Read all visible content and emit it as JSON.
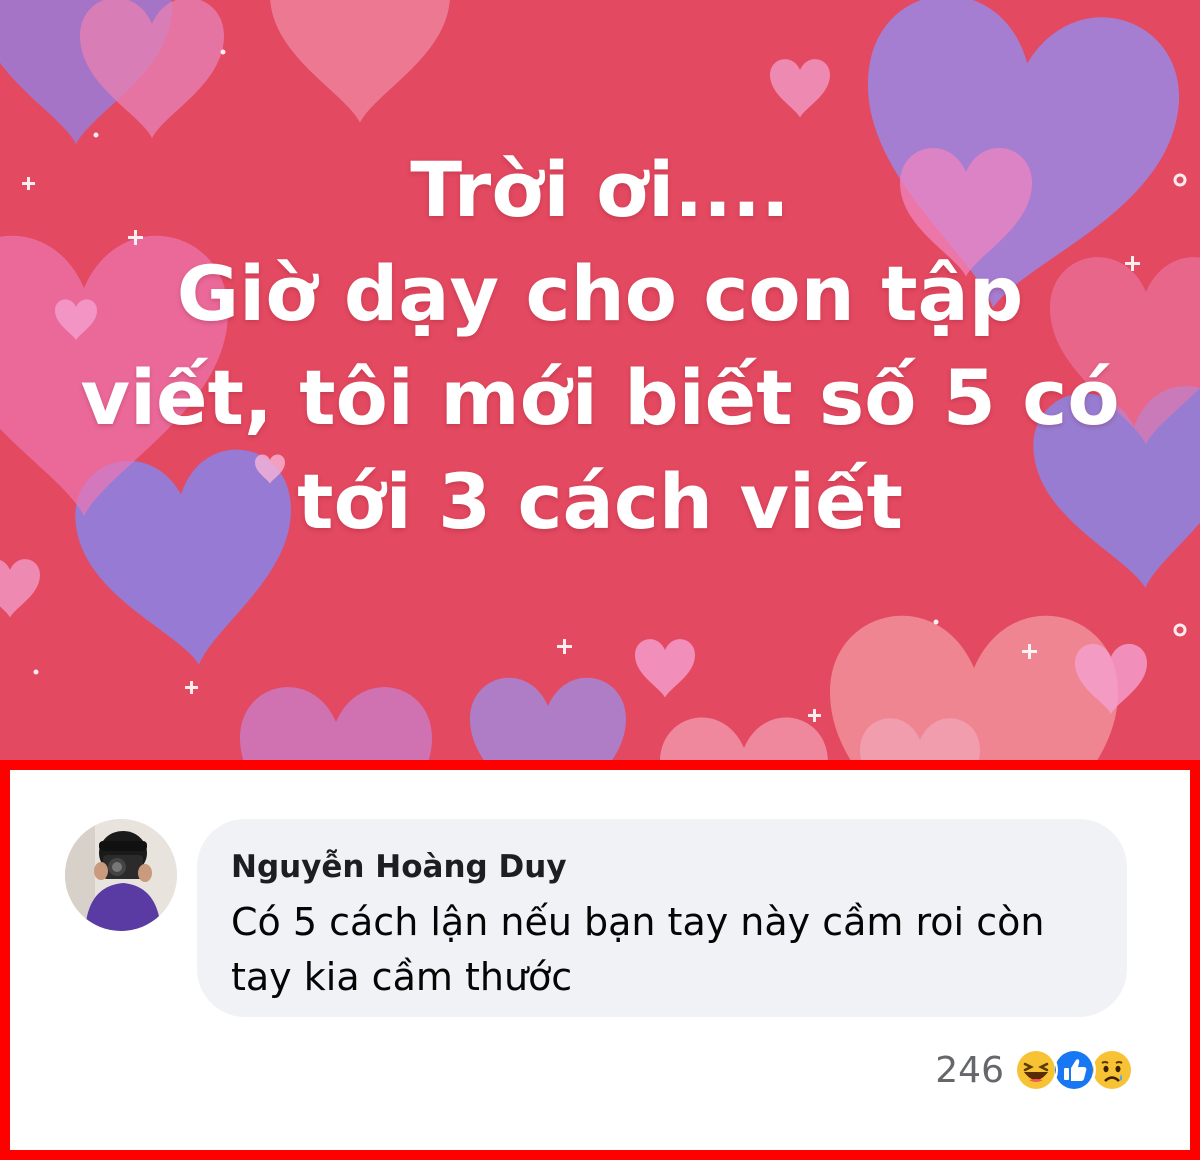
{
  "post": {
    "background_color": "#e34960",
    "text_lines": [
      "Trời ơi....",
      "Giờ dạy cho con tập",
      "viết, tôi mới biết số 5 có",
      "tới 3 cách viết"
    ]
  },
  "comment": {
    "author": "Nguyễn Hoàng Duy",
    "text_lines": [
      "Có 5 cách lận nếu bạn tay này cầm roi còn",
      "tay kia cầm thước"
    ],
    "avatar_icon": "profile-photo",
    "reaction_count": "246",
    "reactions": [
      "haha-icon",
      "like-icon",
      "sad-icon"
    ],
    "highlight_border_color": "#ff0000"
  }
}
